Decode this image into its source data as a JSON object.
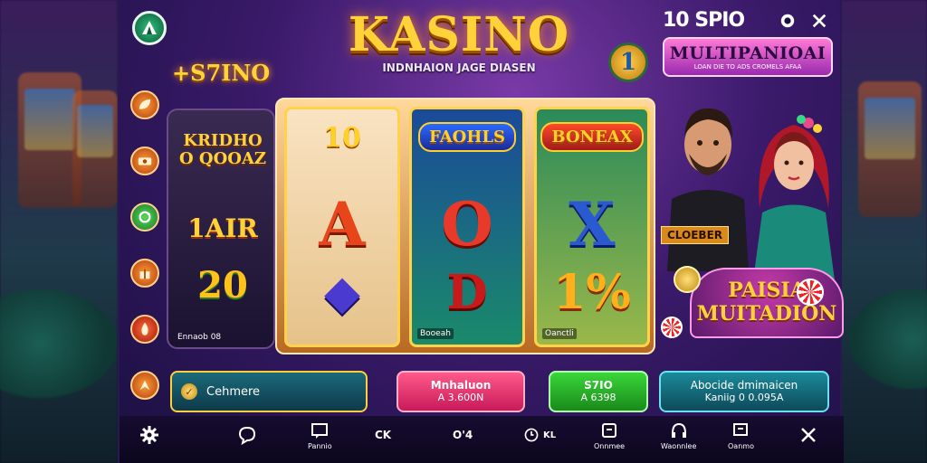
{
  "header": {
    "title": "KASINO",
    "tagline": "INDNHAION JAGE DIASEN",
    "left_subtitle": "+S7INO",
    "promo_count": "10 SPIO",
    "promo_headline": "MULTIPANIOAI",
    "promo_subtext": "LOAN DIE TO ADS CROMELS AFAA",
    "badge_symbol": "1"
  },
  "left_slot": {
    "top_text": "KRIDHO O QOOAZ",
    "mid_text": "1AIR",
    "big_text": "20",
    "footer": "Ennaob 08"
  },
  "reels": [
    {
      "top": "10",
      "mid": "A",
      "bot": "◆",
      "footer": ""
    },
    {
      "top": "FAOHLS",
      "mid": "O",
      "bot": "D",
      "footer": "Booeah"
    },
    {
      "top": "BONEAX",
      "mid": "X",
      "bot": "1%",
      "footer": "Oanctli"
    }
  ],
  "characters": {
    "tag": "CLOEBER",
    "promo_line1": "PAISIA",
    "promo_line2": "MUITADION"
  },
  "actions": {
    "left_label": "Cehmere",
    "pink_line1": "Mnhaluon",
    "pink_line2": "A 3.600N",
    "green_line1": "S7IO",
    "green_line2": "A 6398",
    "teal_line1": "Abocide dmimaicen",
    "teal_line2": "Kaniig 0 0.095A"
  },
  "toolbar": {
    "items": [
      {
        "label": ""
      },
      {
        "label": ""
      },
      {
        "label": "Pannio"
      },
      {
        "label": "CK"
      },
      {
        "label": "Oꞌ4"
      },
      {
        "label": "KL"
      },
      {
        "label": "Onnmee"
      },
      {
        "label": "Waonnlee"
      },
      {
        "label": "Oanmo"
      },
      {
        "label": ""
      }
    ]
  },
  "colors": {
    "gold": "#ffd23a",
    "purple": "#5a2a8a",
    "teal": "#1a8a9a",
    "pink": "#ff5a8a",
    "green": "#3ad63a"
  }
}
